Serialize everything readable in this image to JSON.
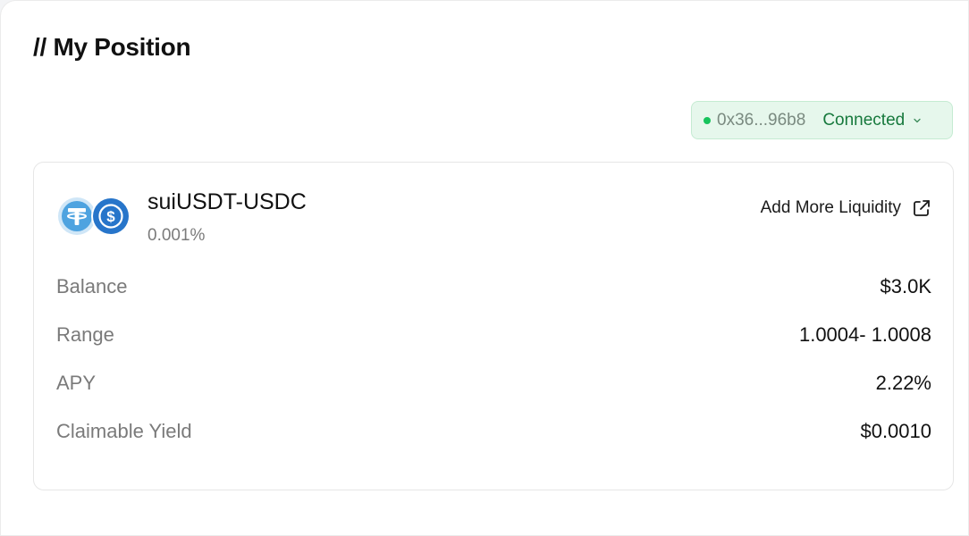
{
  "header": {
    "title": "// My Position"
  },
  "wallet": {
    "address": "0x36...96b8",
    "status": "Connected",
    "status_color": "#17c35c"
  },
  "position": {
    "pair": "suiUSDT-USDC",
    "fee_tier": "0.001%",
    "tokens": [
      {
        "symbol": "USDT",
        "icon": "tether-icon",
        "color": "#4ea3e0"
      },
      {
        "symbol": "USDC",
        "icon": "usdc-icon",
        "color": "#2775ca"
      }
    ],
    "add_liquidity_label": "Add More Liquidity",
    "stats": [
      {
        "label": "Balance",
        "value": "$3.0K"
      },
      {
        "label": "Range",
        "value": "1.0004- 1.0008"
      },
      {
        "label": "APY",
        "value": "2.22%"
      },
      {
        "label": "Claimable Yield",
        "value": "$0.0010"
      }
    ]
  }
}
